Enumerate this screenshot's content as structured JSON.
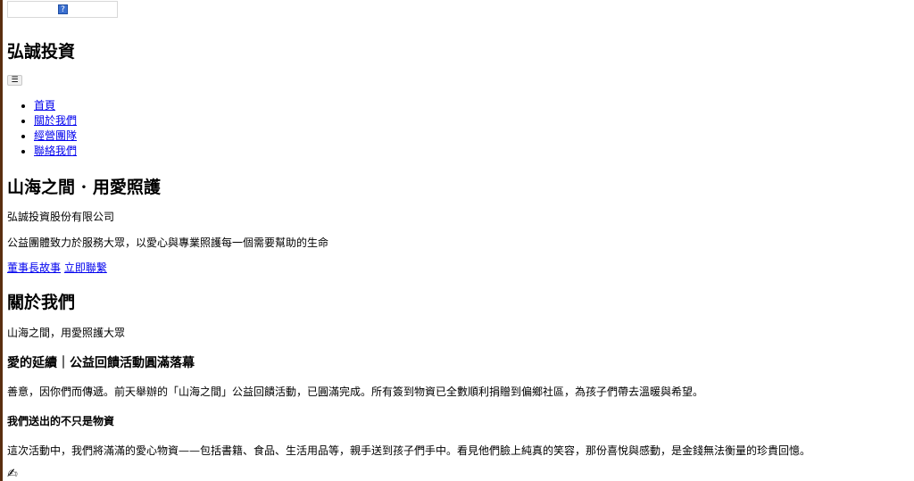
{
  "header": {
    "logo_icon": "broken-image-icon",
    "site_title": "弘誠投資",
    "menu_toggle": "☰"
  },
  "nav": {
    "items": [
      {
        "label": "首頁"
      },
      {
        "label": "關於我們"
      },
      {
        "label": "經營團隊"
      },
      {
        "label": "聯絡我們"
      }
    ]
  },
  "hero": {
    "title": "山海之間 · 用愛照護",
    "company": "弘誠投資股份有限公司",
    "tagline": "公益團體致力於服務大眾，以愛心與專業照護每一個需要幫助的生命",
    "cta_story": "董事長故事",
    "cta_contact": "立即聯繫"
  },
  "about": {
    "title": "關於我們",
    "subtitle": "山海之間，用愛照護大眾",
    "article_title": "愛的延續｜公益回饋活動圓滿落幕",
    "para1": "善意，因你們而傳遞。前天舉辦的「山海之間」公益回饋活動，已圓滿完成。所有簽到物資已全數順利捐贈到偏鄉社區，為孩子們帶去溫暖與希望。",
    "sub_heading": "我們送出的不只是物資",
    "para2": "這次活動中，我們將滿滿的愛心物資——包括書籍、食品、生活用品等，親手送到孩子們手中。看見他們臉上純真的笑容，那份喜悅與感動，是金錢無法衡量的珍貴回憶。",
    "icon": "writing-hand-icon",
    "icon_glyph": "✍"
  },
  "colors": {
    "link": "#0000ee",
    "left_bar": "#5a2e10"
  }
}
